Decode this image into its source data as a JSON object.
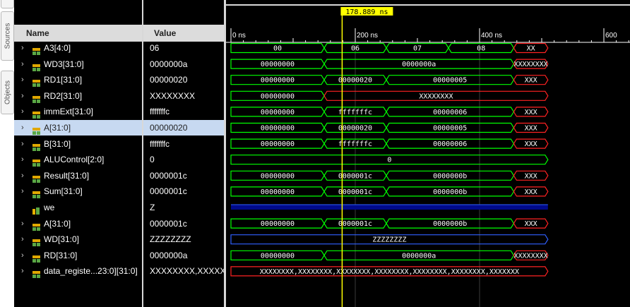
{
  "side_tabs": [
    {
      "label": "Sources"
    },
    {
      "label": "Objects"
    }
  ],
  "columns": {
    "name": "Name",
    "value": "Value"
  },
  "cursor_time": "178.889 ns",
  "ruler": [
    "0 ns",
    "200 ns",
    "400 ns",
    "600"
  ],
  "colors": {
    "valid": "#00ff00",
    "unknown": "#ff2222",
    "highz": "#3060ff",
    "cursor": "#ffff00",
    "selected_row": "#c7d9f1"
  },
  "signals": [
    {
      "name": "A3[4:0]",
      "value": "06",
      "icon": "bus-icon",
      "expand": true,
      "segments": [
        [
          "valid",
          "00"
        ],
        [
          "valid",
          "06"
        ],
        [
          "valid",
          "07"
        ],
        [
          "valid",
          "08"
        ],
        [
          "unknown",
          "XX"
        ]
      ]
    },
    {
      "name": "WD3[31:0]",
      "value": "0000000a",
      "icon": "bus-icon",
      "expand": true,
      "segments": [
        [
          "valid",
          "00000000"
        ],
        [
          "valid",
          "0000000a"
        ],
        [
          "unknown",
          "XXXXXXXX"
        ]
      ]
    },
    {
      "name": "RD1[31:0]",
      "value": "00000020",
      "icon": "bus-icon",
      "expand": true,
      "segments": [
        [
          "valid",
          "00000000"
        ],
        [
          "valid",
          "00000020"
        ],
        [
          "valid",
          "00000005"
        ],
        [
          "unknown",
          "XXX"
        ]
      ]
    },
    {
      "name": "RD2[31:0]",
      "value": "XXXXXXXX",
      "icon": "bus-icon",
      "expand": true,
      "segments": [
        [
          "valid",
          "00000000"
        ],
        [
          "unknown",
          "XXXXXXXX"
        ]
      ]
    },
    {
      "name": "immExt[31:0]",
      "value": "fffffffc",
      "icon": "bus-icon",
      "expand": true,
      "segments": [
        [
          "valid",
          "00000000"
        ],
        [
          "valid",
          "fffffffc"
        ],
        [
          "valid",
          "00000006"
        ],
        [
          "unknown",
          "XXX"
        ]
      ]
    },
    {
      "name": "A[31:0]",
      "value": "00000020",
      "icon": "bus-icon",
      "expand": true,
      "selected": true,
      "segments": [
        [
          "valid",
          "00000000"
        ],
        [
          "valid",
          "00000020"
        ],
        [
          "valid",
          "00000005"
        ],
        [
          "unknown",
          "XXX"
        ]
      ]
    },
    {
      "name": "B[31:0]",
      "value": "fffffffc",
      "icon": "bus-icon",
      "expand": true,
      "segments": [
        [
          "valid",
          "00000000"
        ],
        [
          "valid",
          "fffffffc"
        ],
        [
          "valid",
          "00000006"
        ],
        [
          "unknown",
          "XXX"
        ]
      ]
    },
    {
      "name": "ALUControl[2:0]",
      "value": "0",
      "icon": "bus-icon",
      "expand": true,
      "segments": [
        [
          "valid",
          "0"
        ]
      ]
    },
    {
      "name": "Result[31:0]",
      "value": "0000001c",
      "icon": "bus-icon",
      "expand": true,
      "segments": [
        [
          "valid",
          "00000000"
        ],
        [
          "valid",
          "0000001c"
        ],
        [
          "valid",
          "0000000b"
        ],
        [
          "unknown",
          "XXX"
        ]
      ]
    },
    {
      "name": "Sum[31:0]",
      "value": "0000001c",
      "icon": "bus-icon",
      "expand": true,
      "segments": [
        [
          "valid",
          "00000000"
        ],
        [
          "valid",
          "0000001c"
        ],
        [
          "valid",
          "0000000b"
        ],
        [
          "unknown",
          "XXX"
        ]
      ]
    },
    {
      "name": "we",
      "value": "Z",
      "icon": "wire-icon",
      "expand": false,
      "segments": [
        [
          "highz-line",
          ""
        ]
      ]
    },
    {
      "name": "A[31:0]",
      "value": "0000001c",
      "icon": "bus-icon",
      "expand": true,
      "segments": [
        [
          "valid",
          "00000000"
        ],
        [
          "valid",
          "0000001c"
        ],
        [
          "valid",
          "0000000b"
        ],
        [
          "unknown",
          "XXX"
        ]
      ]
    },
    {
      "name": "WD[31:0]",
      "value": "ZZZZZZZZ",
      "icon": "bus-icon",
      "expand": true,
      "segments": [
        [
          "highz",
          "ZZZZZZZZ"
        ]
      ]
    },
    {
      "name": "RD[31:0]",
      "value": "0000000a",
      "icon": "bus-icon",
      "expand": true,
      "segments": [
        [
          "valid",
          "00000000"
        ],
        [
          "valid",
          "0000000a"
        ],
        [
          "unknown",
          "XXXXXXXX"
        ]
      ]
    },
    {
      "name": "data_registe...23:0][31:0]",
      "value": "XXXXXXXX,XXXXXXXX",
      "icon": "bus-icon",
      "expand": true,
      "segments": [
        [
          "unknown",
          "XXXXXXXX,XXXXXXXX,XXXXXXXX,XXXXXXXX,XXXXXXXX,XXXXXXXX,XXXXXXX"
        ]
      ]
    }
  ]
}
